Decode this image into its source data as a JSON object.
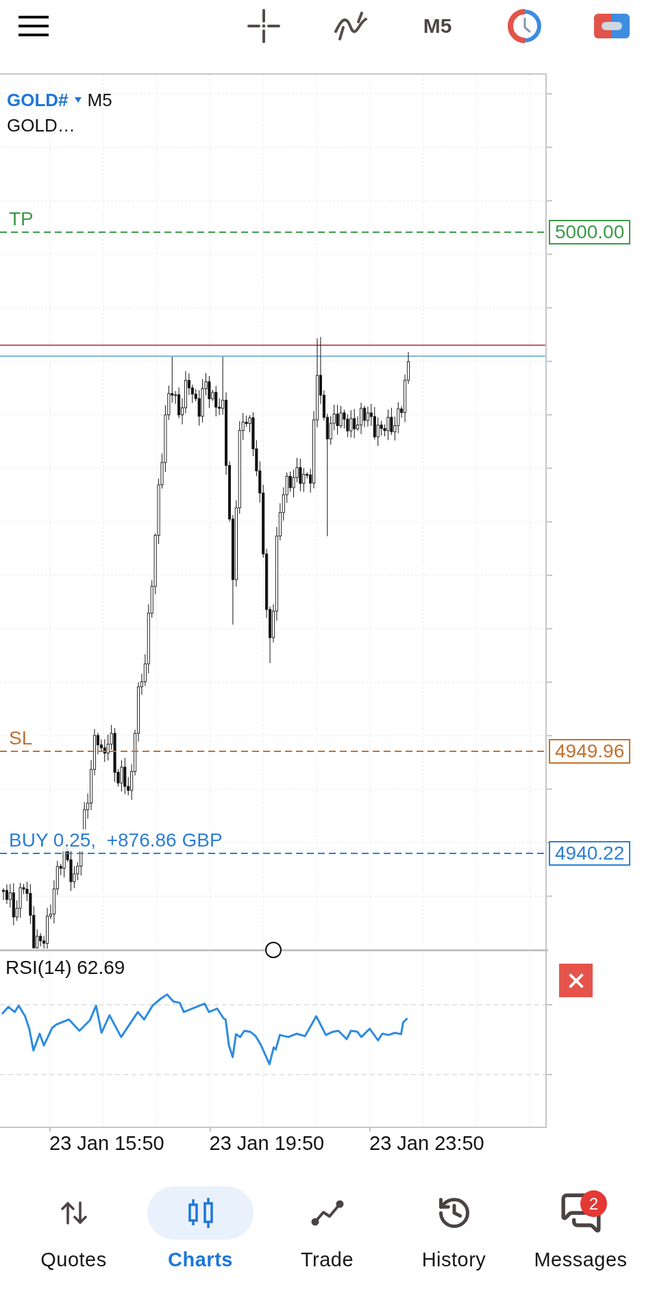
{
  "toolbar": {
    "timeframe": "M5"
  },
  "chart": {
    "symbol": "GOLD#",
    "timeframe": "M5",
    "description": "GOLD…",
    "levels": [
      {
        "kind": "tp",
        "label": "TP",
        "price": "5000.00",
        "color": "#3c9a48"
      },
      {
        "kind": "sl",
        "label": "SL",
        "price": "4949.96",
        "color": "#c2712f"
      },
      {
        "kind": "position",
        "label": "BUY 0.25,  +876.86 GBP",
        "price": "4940.22",
        "color": "#2d7ed4"
      }
    ]
  },
  "indicator": {
    "label": "RSI(14) 62.69"
  },
  "time_axis": [
    "23 Jan 15:50",
    "23 Jan 19:50",
    "23 Jan 23:50"
  ],
  "nav": [
    {
      "label": "Quotes",
      "selected": false
    },
    {
      "label": "Charts",
      "selected": true
    },
    {
      "label": "Trade",
      "selected": false
    },
    {
      "label": "History",
      "selected": false
    },
    {
      "label": "Messages",
      "selected": false,
      "badge": "2"
    }
  ]
}
